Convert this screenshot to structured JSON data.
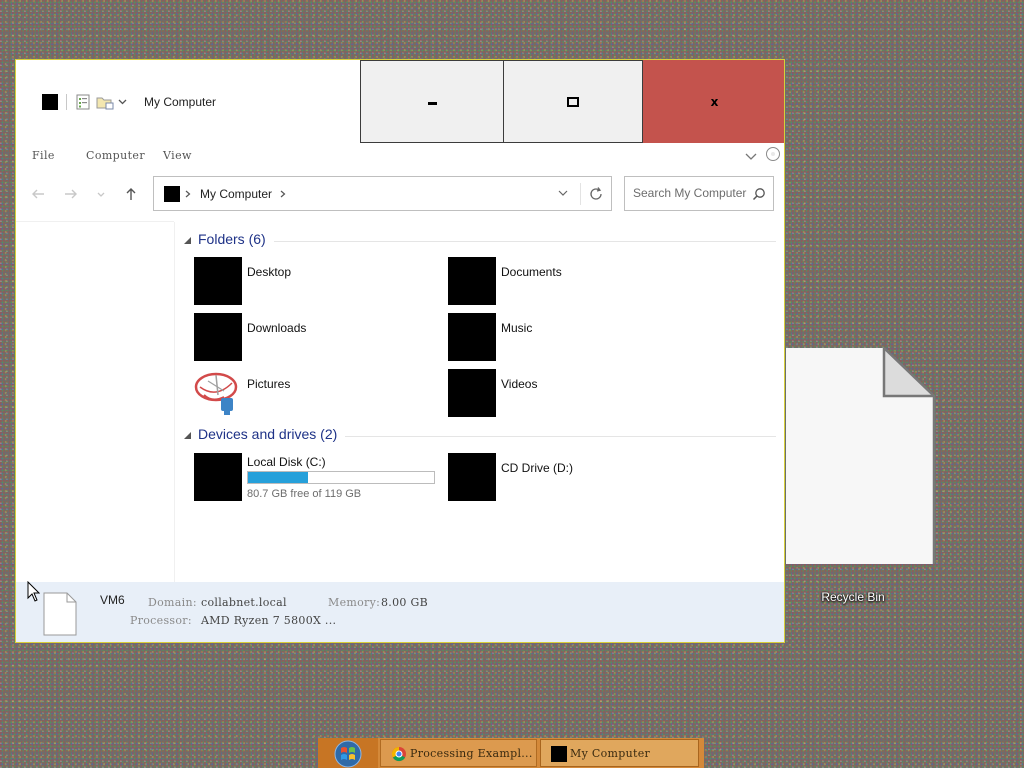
{
  "desktop": {
    "icons": [
      {
        "label": "Recycle Bin"
      }
    ]
  },
  "window": {
    "title": "My Computer",
    "controls": {
      "minimize": "minimize",
      "maximize": "maximize",
      "close": "x"
    }
  },
  "menubar": {
    "items": [
      "File",
      "Computer",
      "View"
    ]
  },
  "navigation": {
    "address": {
      "path": "My Computer"
    },
    "search": {
      "placeholder": "Search My Computer"
    }
  },
  "content": {
    "groups": [
      {
        "title": "Folders (6)",
        "items": [
          "Desktop",
          "Documents",
          "Downloads",
          "Music",
          "Pictures",
          "Videos"
        ]
      },
      {
        "title": "Devices and drives (2)",
        "drives": [
          {
            "name": "Local Disk (C:)",
            "free_text": "80.7 GB free of 119 GB",
            "used_fraction": 0.322
          },
          {
            "name": "CD Drive (D:)"
          }
        ]
      }
    ]
  },
  "details": {
    "name": "VM6",
    "domain_label": "Domain:",
    "domain": "collabnet.local",
    "memory_label": "Memory:",
    "memory": "8.00 GB",
    "processor_label": "Processor:",
    "processor": "AMD Ryzen 7 5800X ..."
  },
  "taskbar": {
    "buttons": [
      {
        "label": "Processing Exampl...",
        "icon": "chrome-icon"
      },
      {
        "label": "My Computer",
        "icon": "computer-icon"
      }
    ]
  },
  "colors": {
    "accent": "#26a0da",
    "close_button": "#c4534d",
    "details_pane": "#e8eff8",
    "taskbar": "#d4893a",
    "window_border": "#d8cf3a"
  }
}
